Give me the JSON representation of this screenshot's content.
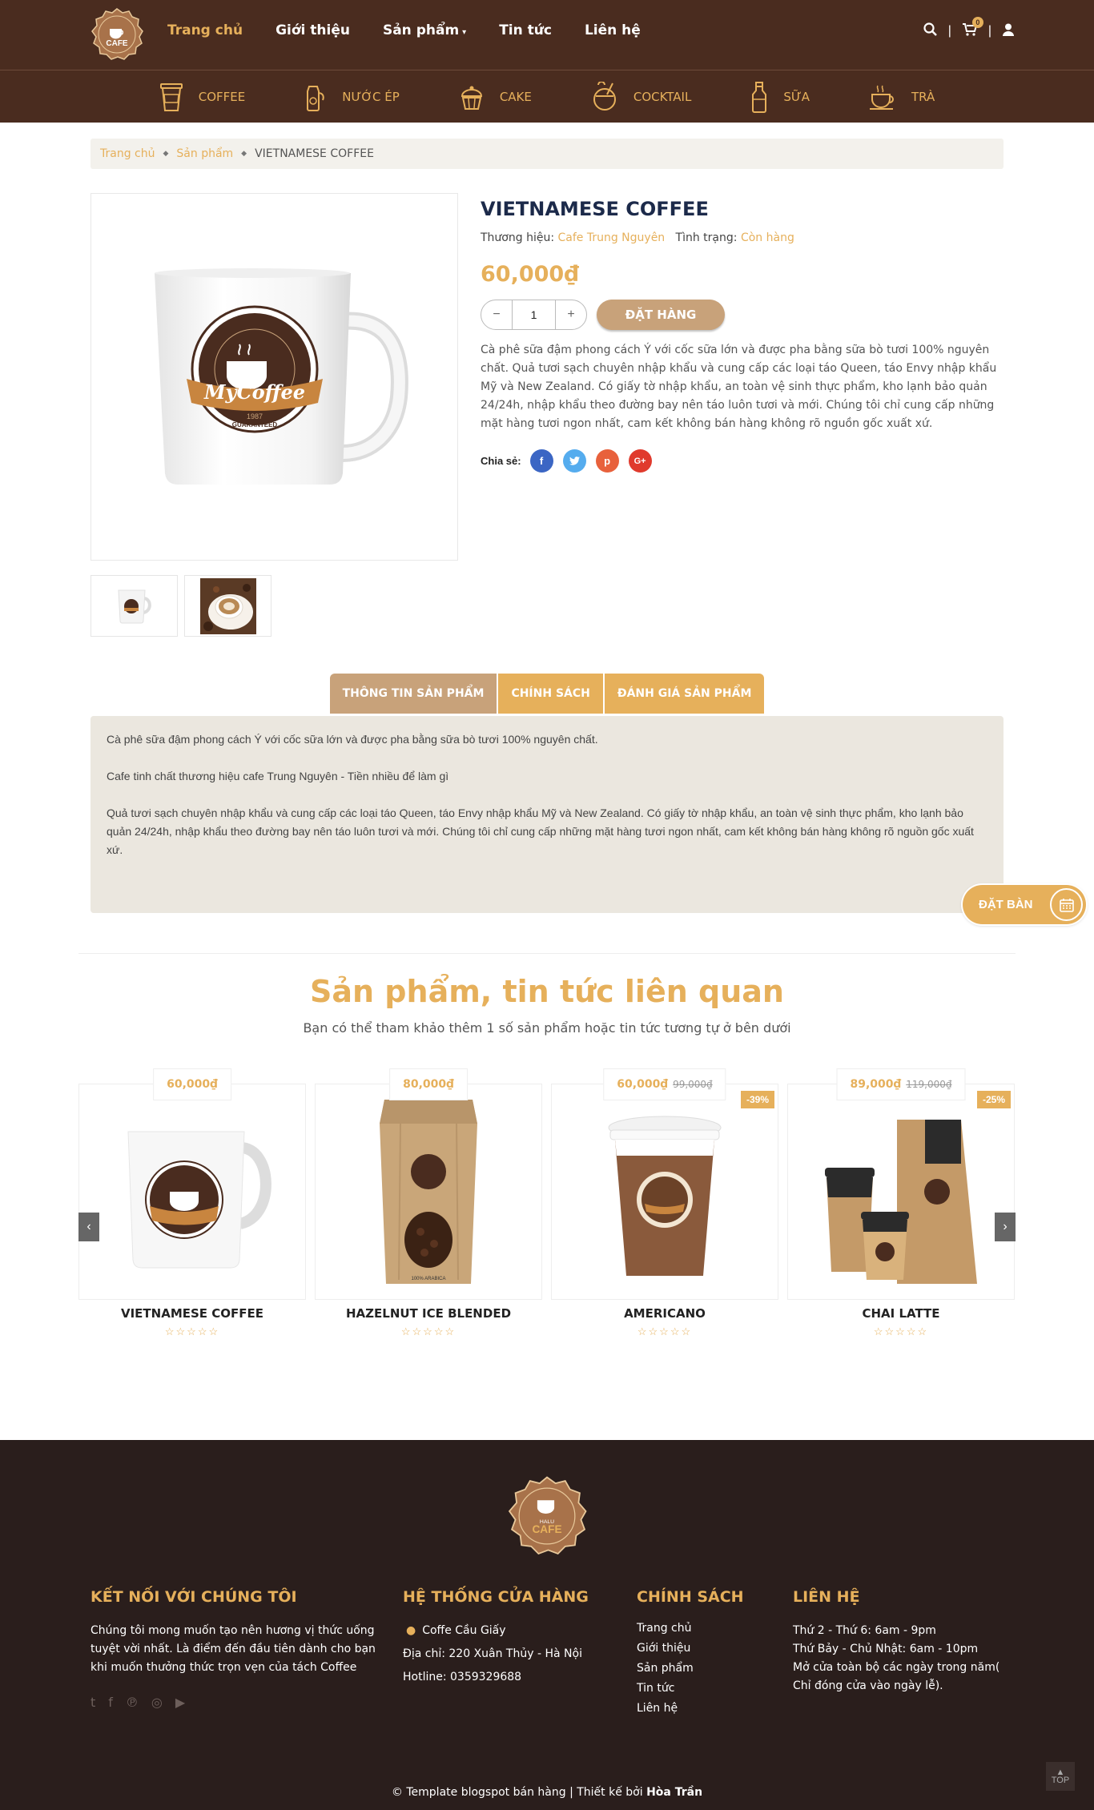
{
  "header": {
    "logo_text": "CAFE",
    "nav": [
      {
        "label": "Trang chủ",
        "active": true
      },
      {
        "label": "Giới thiệu"
      },
      {
        "label": "Sản phẩm",
        "has_dropdown": true
      },
      {
        "label": "Tin tức"
      },
      {
        "label": "Liên hệ"
      }
    ],
    "cart_count": "0",
    "icons": [
      "search-icon",
      "cart-icon",
      "user-icon"
    ]
  },
  "categories": [
    {
      "label": "Coffee",
      "icon": "coffee-cup-icon"
    },
    {
      "label": "Nước ép",
      "icon": "juice-icon"
    },
    {
      "label": "Cake",
      "icon": "cake-icon"
    },
    {
      "label": "Cocktail",
      "icon": "cocktail-icon"
    },
    {
      "label": "Sữa",
      "icon": "milk-bottle-icon"
    },
    {
      "label": "Trà",
      "icon": "tea-cup-icon"
    }
  ],
  "breadcrumb": [
    "Trang chủ",
    "Sản phẩm",
    "VIETNAMESE COFFEE"
  ],
  "product": {
    "title": "VIETNAMESE COFFEE",
    "brand_label": "Thương hiệu:",
    "brand": "Cafe Trung Nguyên",
    "status_label": "Tình trạng:",
    "status": "Còn hàng",
    "price": "60,000₫",
    "qty": "1",
    "qty_minus": "−",
    "qty_plus": "+",
    "order_label": "ĐẶT HÀNG",
    "description": "Cà phê sữa đậm phong cách Ý với cốc sữa lớn và được pha bằng sữa bò tươi 100% nguyên chất. Quả tươi sạch chuyên nhập khẩu và cung cấp các loại táo Queen, táo Envy nhập khẩu Mỹ và New Zealand. Có giấy tờ nhập khẩu, an toàn vệ sinh thực phẩm, kho lạnh bảo quản 24/24h, nhập khẩu theo đường bay nên táo luôn tươi và mới. Chúng tôi chỉ cung cấp những mặt hàng tươi ngon nhất, cam kết không bán hàng không rõ nguồn gốc xuất xứ.",
    "share_label": "Chia sẻ:",
    "mug_logo": "MyCoffee",
    "mug_ring": "PREMIUM QUALITY COFFEE & ROASTERS",
    "mug_year": "1987",
    "mug_badge": "GUARANTEED"
  },
  "tabs": [
    {
      "label": "THÔNG TIN SẢN PHẨM",
      "active": true
    },
    {
      "label": "CHÍNH SÁCH"
    },
    {
      "label": "ĐÁNH GIÁ SẢN PHẨM"
    }
  ],
  "tab_content": [
    "Cà phê sữa đậm phong cách Ý với cốc sữa lớn và được pha bằng sữa bò tươi 100% nguyên chất.",
    "Cafe tinh chất thương hiệu cafe Trung Nguyên - Tiền nhiều để làm gì",
    "Quả tươi sạch chuyên nhập khẩu và cung cấp các loại táo Queen, táo Envy nhập khẩu Mỹ và New Zealand. Có giấy tờ nhập khẩu, an toàn vệ sinh thực phẩm, kho lạnh bảo quản 24/24h, nhập khẩu theo đường bay nên táo luôn tươi và mới. Chúng tôi chỉ cung cấp những mặt hàng tươi ngon nhất, cam kết không bán hàng không rõ nguồn gốc xuất xứ."
  ],
  "book_table": "ĐẶT BÀN",
  "related": {
    "title": "Sản phẩm, tin tức liên quan",
    "subtitle": "Bạn có thể tham khảo thêm 1 số sản phẩm hoặc tin tức tương tự ở bên dưới",
    "items": [
      {
        "name": "VIETNAMESE COFFEE",
        "price": "60,000₫",
        "old_price": "",
        "sale": ""
      },
      {
        "name": "HAZELNUT ICE BLENDED",
        "price": "80,000₫",
        "old_price": "",
        "sale": "",
        "bag_label": "100% ARABICA"
      },
      {
        "name": "AMERICANO",
        "price": "60,000₫",
        "old_price": "99,000₫",
        "sale": "-39%"
      },
      {
        "name": "CHAI LATTE",
        "price": "89,000₫",
        "old_price": "119,000₫",
        "sale": "-25%"
      }
    ]
  },
  "footer": {
    "logo_top": "HALU",
    "logo_text": "CAFE",
    "connect": {
      "title": "Kết nối với chúng tôi",
      "text": "Chúng tôi mong muốn tạo nên hương vị thức uống tuyệt vời nhất. Là điểm đến đầu tiên dành cho bạn khi muốn thưởng thức trọn vẹn của tách Coffee"
    },
    "stores": {
      "title": "Hệ thống cửa hàng",
      "name": "Coffe Cầu Giấy",
      "address": "Địa chỉ: 220 Xuân Thủy - Hà Nội",
      "hotline": "Hotline: 0359329688"
    },
    "policy": {
      "title": "Chính sách",
      "links": [
        "Trang chủ",
        "Giới thiệu",
        "Sản phẩm",
        "Tin tức",
        "Liên hệ"
      ]
    },
    "contact": {
      "title": "Liên hệ",
      "lines": [
        "Thứ 2 - Thứ 6: 6am - 9pm",
        "Thứ Bảy - Chủ Nhật: 6am - 10pm",
        "Mở cửa toàn bộ các ngày trong năm(",
        "Chỉ đóng cửa vào ngày lễ)."
      ]
    },
    "copyright": "© Template blogspot bán hàng | Thiết kế bởi",
    "author": "Hòa Trần",
    "top_label": "TOP"
  },
  "colors": {
    "brown": "#4a2c1f",
    "gold": "#e6b05b",
    "tan": "#c8a27a",
    "footer_bg": "#2a1e1c"
  }
}
